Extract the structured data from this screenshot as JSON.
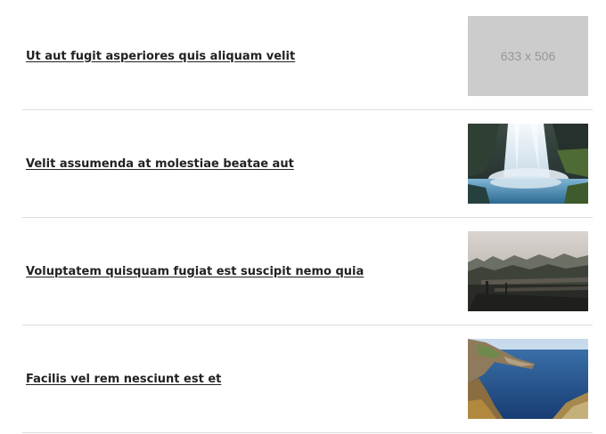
{
  "articles": [
    {
      "title": "Ut aut fugit asperiores quis aliquam velit",
      "thumbnail": {
        "kind": "placeholder",
        "label": "633 x 506"
      }
    },
    {
      "title": "Velit assumenda at molestiae beatae aut",
      "thumbnail": {
        "kind": "photo",
        "subject": "waterfall"
      }
    },
    {
      "title": "Voluptatem quisquam fugiat est suscipit nemo quia",
      "thumbnail": {
        "kind": "photo",
        "subject": "foggy-forest-bridge"
      }
    },
    {
      "title": "Facilis vel rem nesciunt est et",
      "thumbnail": {
        "kind": "photo",
        "subject": "coastal-cliffs"
      }
    }
  ]
}
